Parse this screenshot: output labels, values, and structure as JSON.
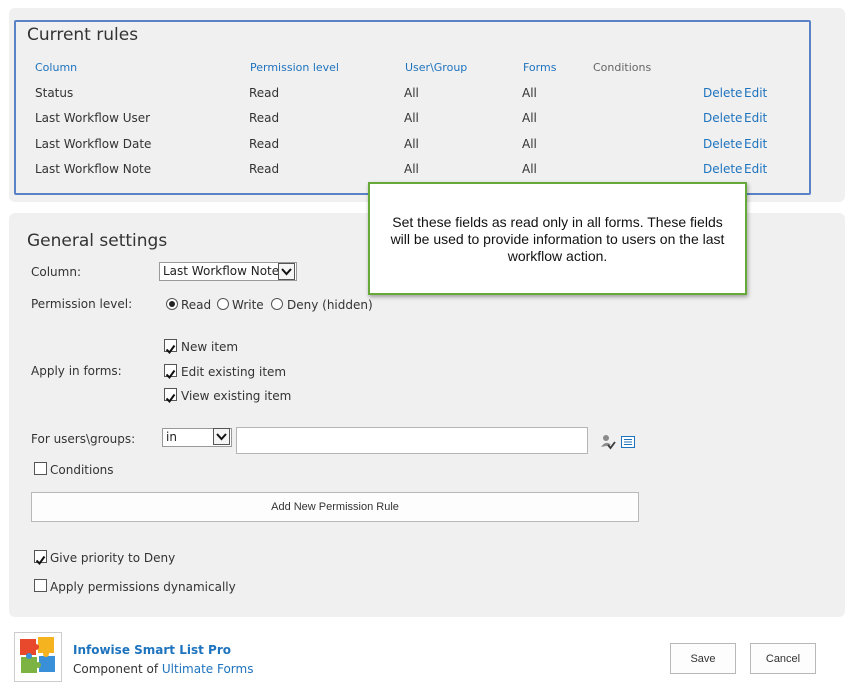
{
  "current_rules": {
    "title": "Current rules",
    "columns": [
      "Column",
      "Permission level",
      "User\\Group",
      "Forms",
      "Conditions"
    ],
    "rows": [
      {
        "column": "Status",
        "permission": "Read",
        "user_group": "All",
        "forms": "All",
        "delete": "Delete",
        "edit": "Edit"
      },
      {
        "column": "Last Workflow User",
        "permission": "Read",
        "user_group": "All",
        "forms": "All",
        "delete": "Delete",
        "edit": "Edit"
      },
      {
        "column": "Last Workflow Date",
        "permission": "Read",
        "user_group": "All",
        "forms": "All",
        "delete": "Delete",
        "edit": "Edit"
      },
      {
        "column": "Last Workflow Note",
        "permission": "Read",
        "user_group": "All",
        "forms": "All",
        "delete": "Delete",
        "edit": "Edit"
      }
    ]
  },
  "callout": {
    "text": "Set these fields as read only in all forms. These fields will be used to provide information to users on the last workflow action."
  },
  "general_settings": {
    "title": "General settings",
    "column_label": "Column:",
    "column_value": "Last Workflow Note",
    "permission_label": "Permission level:",
    "permission_options": [
      "Read",
      "Write",
      "Deny (hidden)"
    ],
    "permission_selected": "Read",
    "apply_forms_label": "Apply in forms:",
    "forms_options": [
      {
        "label": "New item",
        "checked": true
      },
      {
        "label": "Edit existing item",
        "checked": true
      },
      {
        "label": "View existing item",
        "checked": true
      }
    ],
    "users_label": "For users\\groups:",
    "users_operator": "in",
    "users_value": "",
    "conditions_label": "Conditions",
    "conditions_checked": false,
    "add_rule_button": "Add New Permission Rule",
    "priority_deny_label": "Give priority to Deny",
    "priority_deny_checked": true,
    "dynamic_label": "Apply permissions dynamically",
    "dynamic_checked": false
  },
  "footer": {
    "product_name": "Infowise Smart List Pro",
    "component_prefix": "Component of",
    "component_link": "Ultimate Forms",
    "save_button": "Save",
    "cancel_button": "Cancel"
  },
  "colors": {
    "link": "#1e73be",
    "highlight_border": "#5b82c7",
    "callout_border": "#66a83a",
    "panel_bg": "#f0f0f0"
  }
}
